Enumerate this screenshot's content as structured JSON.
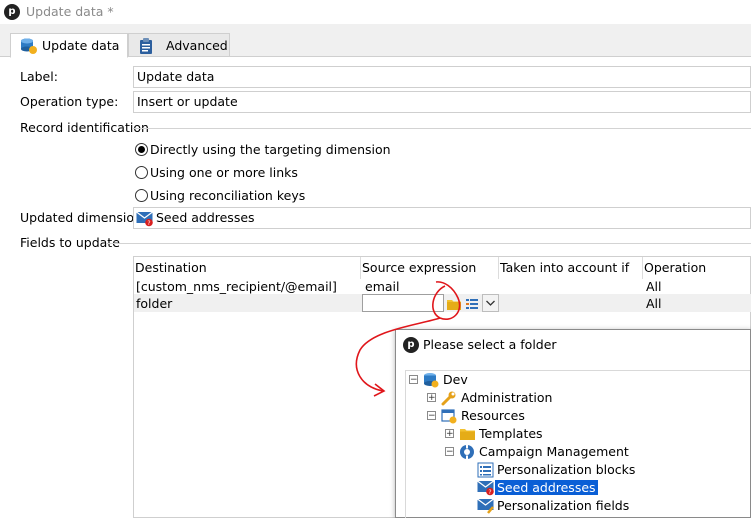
{
  "window": {
    "title": "Update data *"
  },
  "tabs": [
    {
      "label": "Update data",
      "active": true,
      "icon": "database-icon"
    },
    {
      "label": "Advanced",
      "active": false,
      "icon": "clipboard-icon"
    }
  ],
  "form": {
    "label_caption": "Label:",
    "label_value": "Update data",
    "operation_caption": "Operation type:",
    "operation_value": "Insert or update",
    "record_identification_caption": "Record identification",
    "radios": [
      {
        "label": "Directly using the targeting dimension",
        "checked": true
      },
      {
        "label": "Using one or more links",
        "checked": false
      },
      {
        "label": "Using reconciliation keys",
        "checked": false
      }
    ],
    "updated_dimension_caption": "Updated dimension:",
    "updated_dimension_value": "Seed addresses",
    "fields_caption": "Fields to update"
  },
  "grid": {
    "columns": [
      "Destination",
      "Source expression",
      "Taken into account if",
      "Operation"
    ],
    "rows": [
      {
        "destination": "[custom_nms_recipient/@email]",
        "source": "email",
        "condition": "",
        "operation": "All"
      },
      {
        "destination": "folder",
        "source": "",
        "condition": "",
        "operation": "All"
      }
    ]
  },
  "popup": {
    "title": "Please select a folder",
    "tree": {
      "root": "Dev",
      "administration": "Administration",
      "resources": "Resources",
      "templates": "Templates",
      "campaign_management": "Campaign Management",
      "personalization_blocks": "Personalization blocks",
      "seed_addresses": "Seed addresses",
      "personalization_fields": "Personalization fields"
    }
  },
  "colors": {
    "selection": "#0a5fd6",
    "annotation": "#e0161b",
    "folder": "#f2c231"
  }
}
